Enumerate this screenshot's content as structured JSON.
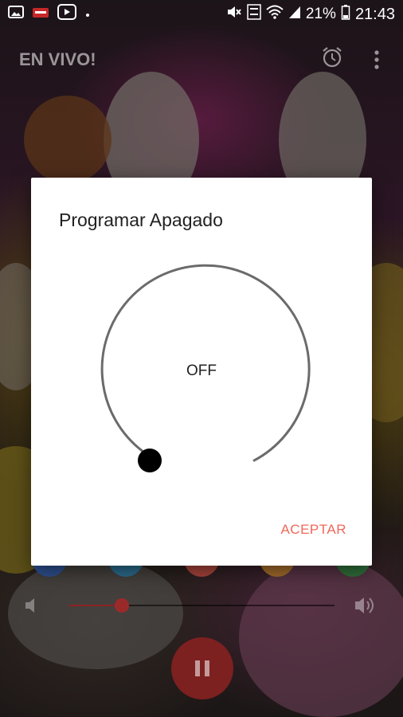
{
  "status_bar": {
    "battery": "21%",
    "time": "21:43",
    "icons": [
      "gallery-icon",
      "notification-icon",
      "youtube-icon",
      "dot-icon",
      "mute-icon",
      "volte-icon",
      "wifi-icon",
      "signal-icon",
      "battery-icon"
    ]
  },
  "app_bar": {
    "title": "EN VIVO!",
    "icons": [
      "alarm-clock-icon",
      "more-vert-icon"
    ]
  },
  "dialog": {
    "title": "Programar Apagado",
    "dial_value": "OFF",
    "accept_label": "ACEPTAR",
    "accent_color": "#f0685a"
  },
  "player": {
    "volume_fraction": 0.2,
    "controls": [
      "volume-low-icon",
      "volume-high-icon",
      "pause-icon"
    ],
    "social_icons": [
      "facebook-icon",
      "twitter-icon",
      "instagram-icon",
      "web-icon",
      "whatsapp-icon"
    ],
    "accent_color": "#9a2a2a"
  }
}
